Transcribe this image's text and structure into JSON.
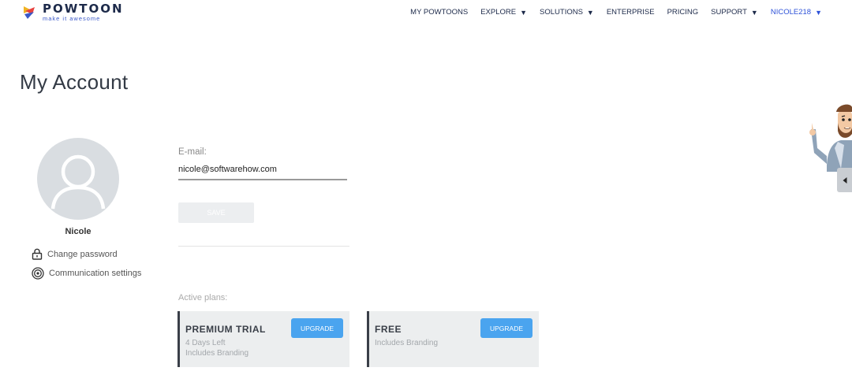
{
  "brand": {
    "name": "POWTOON",
    "tagline": "make it awesome"
  },
  "nav": {
    "items": [
      {
        "label": "MY POWTOONS",
        "has_caret": false
      },
      {
        "label": "EXPLORE",
        "has_caret": true
      },
      {
        "label": "SOLUTIONS",
        "has_caret": true
      },
      {
        "label": "ENTERPRISE",
        "has_caret": false
      },
      {
        "label": "PRICING",
        "has_caret": false
      },
      {
        "label": "SUPPORT",
        "has_caret": true
      }
    ],
    "user": {
      "label": "NICOLE218",
      "caret": "▼"
    },
    "caret": "▼"
  },
  "page": {
    "title": "My Account"
  },
  "profile": {
    "name": "Nicole",
    "links": [
      {
        "label": "Change password",
        "icon": "lock-icon"
      },
      {
        "label": "Communication settings",
        "icon": "broadcast-icon"
      }
    ]
  },
  "account_form": {
    "email_label": "E-mail:",
    "email_value": "nicole@softwarehow.com",
    "save_label": "SAVE"
  },
  "plans": {
    "label": "Active plans:",
    "items": [
      {
        "name": "PREMIUM TRIAL",
        "details": [
          "4 Days Left",
          "Includes Branding"
        ],
        "button": "UPGRADE"
      },
      {
        "name": "FREE",
        "details": [
          "Includes Branding"
        ],
        "button": "UPGRADE"
      }
    ]
  },
  "colors": {
    "accent": "#4aa4ef",
    "user_link": "#2e52d8",
    "navy": "#1d2a4a"
  }
}
